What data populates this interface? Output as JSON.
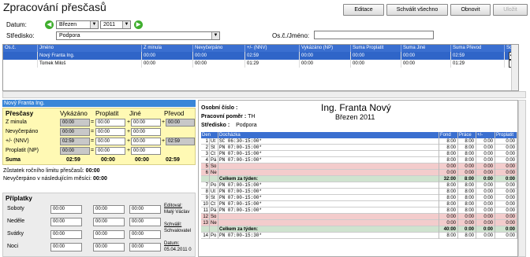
{
  "title": "Zpracování přesčasů",
  "toolbar": {
    "editace": "Editace",
    "schvalit": "Schválit všechno",
    "obnovit": "Obnovit",
    "ulozit": "Uložit"
  },
  "filters": {
    "datum_label": "Datum:",
    "month": "Březen",
    "year": "2011",
    "stredisko_label": "Středisko:",
    "stredisko": "Podpora",
    "osc_label": "Os.č./Jméno:",
    "osc_value": ""
  },
  "grid": {
    "headers": [
      "Os.č.",
      "Jméno",
      "Z minula",
      "Nevyčerpáno",
      "+/- (NNV)",
      "Vykázáno (NP)",
      "Suma Proplatit",
      "Suma Jiné",
      "Suma Převod",
      "Schváli"
    ],
    "rows": [
      {
        "name": "Nový Franta Ing.",
        "zminula": "00:00",
        "nevycerpano": "00:00",
        "nnv": "02:59",
        "np": "00:00",
        "proplatit": "00:00",
        "jine": "00:00",
        "prevod": "02:59",
        "checked": "✔",
        "selected": true
      },
      {
        "name": "Tomek Miloš",
        "zminula": "00:00",
        "nevycerpano": "00:00",
        "nnv": "01:29",
        "np": "00:00",
        "proplatit": "00:00",
        "jine": "00:00",
        "prevod": "01:29",
        "checked": "",
        "selected": false
      }
    ]
  },
  "left": {
    "header": "Nový Franta Ing.",
    "cols": [
      "Přesčasy",
      "Vykázáno",
      "Proplatit",
      "Jiné",
      "Převod"
    ],
    "rows": [
      {
        "label": "Z minula",
        "v": "00:00",
        "p": "00:00",
        "j": "00:00",
        "pr": "00:00"
      },
      {
        "label": "Nevyčerpáno",
        "v": "00:00",
        "p": "00:00",
        "j": "00:00",
        "pr": ""
      },
      {
        "label": "+/- (NNV)",
        "v": "02:59",
        "p": "00:00",
        "j": "00:00",
        "pr": "02:59"
      },
      {
        "label": "Proplatit (NP)",
        "v": "00:00",
        "p": "00:00",
        "j": "00:00",
        "pr": ""
      }
    ],
    "suma": {
      "label": "Suma",
      "v": "02:59",
      "p": "00:00",
      "j": "00:00",
      "pr": "02:59"
    },
    "zustatek": "Zůstatek ročního limitu přesčasů:",
    "zustatek_v": "00:00",
    "nevycerpano": "Nevyčerpáno v následujícím měsíci:",
    "nevycerpano_v": "00:00",
    "priplatky": "Příplatky",
    "pr_rows": [
      "Soboty",
      "Neděle",
      "Svátky",
      "Noci"
    ],
    "pr_val": "00:00",
    "editoval": "Editoval:",
    "editoval_v": "Malý Václav",
    "schvalil": "Schválil:",
    "schvalil_v": "Schvalovatel",
    "datum": "Datum:",
    "datum_v": "05.04.2011 0"
  },
  "right": {
    "osc_label": "Osobní číslo :",
    "name": "Ing. Franta Nový",
    "pomer_label": "Pracovní poměr :",
    "pomer": "TH",
    "month": "Březen 2011",
    "stredisko_label": "Středisko :",
    "stredisko": "Podpora",
    "head": [
      "Den",
      "Docházka",
      "Fond",
      "Práce",
      "+/-",
      "Proplatit"
    ],
    "rows": [
      {
        "d": "1",
        "w": "Út",
        "a": "SC 06:30-15:00*",
        "f": "8:00",
        "p": "8:00",
        "pm": "0:00",
        "pr": "0:00",
        "t": "n"
      },
      {
        "d": "2",
        "w": "St",
        "a": "PN 07:00-15:00*",
        "f": "8:00",
        "p": "8:00",
        "pm": "0:00",
        "pr": "0:00",
        "t": "n"
      },
      {
        "d": "3",
        "w": "Čt",
        "a": "PN 07:00-15:00*",
        "f": "8:00",
        "p": "8:00",
        "pm": "0:00",
        "pr": "0:00",
        "t": "n"
      },
      {
        "d": "4",
        "w": "Pá",
        "a": "PN 07:00-15:00*",
        "f": "8:00",
        "p": "8:00",
        "pm": "0:00",
        "pr": "0:00",
        "t": "n"
      },
      {
        "d": "5",
        "w": "So",
        "a": "",
        "f": "0:00",
        "p": "0:00",
        "pm": "0:00",
        "pr": "0:00",
        "t": "w"
      },
      {
        "d": "6",
        "w": "Ne",
        "a": "",
        "f": "0:00",
        "p": "0:00",
        "pm": "0:00",
        "pr": "0:00",
        "t": "w"
      },
      {
        "d": "",
        "w": "",
        "a": "Celkem za týden:",
        "f": "32:00",
        "p": "8:00",
        "pm": "0:00",
        "pr": "0:00",
        "t": "s"
      },
      {
        "d": "7",
        "w": "Po",
        "a": "PN 07:00-15:00*",
        "f": "8:00",
        "p": "8:00",
        "pm": "0:00",
        "pr": "0:00",
        "t": "n"
      },
      {
        "d": "8",
        "w": "Út",
        "a": "PN 07:00-15:00*",
        "f": "8:00",
        "p": "8:00",
        "pm": "0:00",
        "pr": "0:00",
        "t": "n"
      },
      {
        "d": "9",
        "w": "St",
        "a": "PN 07:00-15:00*",
        "f": "8:00",
        "p": "8:00",
        "pm": "0:00",
        "pr": "0:00",
        "t": "n"
      },
      {
        "d": "10",
        "w": "Čt",
        "a": "PN 07:00-15:00*",
        "f": "8:00",
        "p": "8:00",
        "pm": "0:00",
        "pr": "0:00",
        "t": "n"
      },
      {
        "d": "11",
        "w": "Pá",
        "a": "PN 07:00-15:00*",
        "f": "8:00",
        "p": "8:00",
        "pm": "0:00",
        "pr": "0:00",
        "t": "n"
      },
      {
        "d": "12",
        "w": "So",
        "a": "",
        "f": "0:00",
        "p": "0:00",
        "pm": "0:00",
        "pr": "0:00",
        "t": "w"
      },
      {
        "d": "13",
        "w": "Ne",
        "a": "",
        "f": "0:00",
        "p": "0:00",
        "pm": "0:00",
        "pr": "0:00",
        "t": "w"
      },
      {
        "d": "",
        "w": "",
        "a": "Celkem za týden:",
        "f": "40:00",
        "p": "0:00",
        "pm": "0:00",
        "pr": "0:00",
        "t": "s"
      },
      {
        "d": "14",
        "w": "Po",
        "a": "PN 07:00-15:30*",
        "f": "8:00",
        "p": "8:00",
        "pm": "0:00",
        "pr": "0:00",
        "t": "n"
      }
    ]
  }
}
